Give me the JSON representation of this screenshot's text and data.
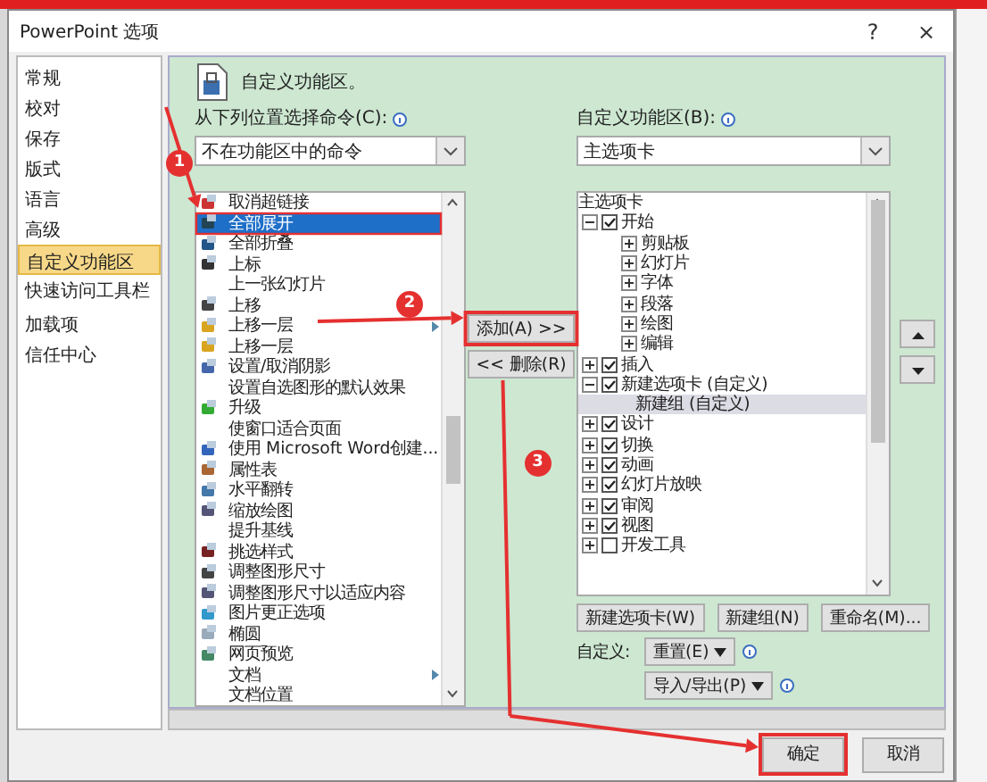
{
  "window": {
    "title": "PowerPoint 选项",
    "help": "?",
    "close": "×"
  },
  "sidebar": {
    "groups": [
      {
        "items": [
          {
            "label": "常规",
            "selected": false
          },
          {
            "label": "校对",
            "selected": false
          },
          {
            "label": "保存",
            "selected": false
          },
          {
            "label": "版式",
            "selected": false
          },
          {
            "label": "语言",
            "selected": false
          },
          {
            "label": "高级",
            "selected": false
          },
          {
            "label": "自定义功能区",
            "selected": true
          },
          {
            "label": "快速访问工具栏",
            "selected": false
          }
        ]
      },
      {
        "items": [
          {
            "label": "加载项",
            "selected": false
          },
          {
            "label": "信任中心",
            "selected": false
          }
        ]
      }
    ]
  },
  "header": {
    "title": "自定义功能区。"
  },
  "commands": {
    "label": "从下列位置选择命令(C):",
    "dropdown": "不在功能区中的命令",
    "items": [
      {
        "label": "取消超链接",
        "icon": true,
        "submenu": false,
        "selected": false
      },
      {
        "label": "全部展开",
        "icon": true,
        "submenu": false,
        "selected": true
      },
      {
        "label": "全部折叠",
        "icon": true,
        "submenu": false,
        "selected": false
      },
      {
        "label": "上标",
        "icon": true,
        "submenu": false,
        "selected": false
      },
      {
        "label": "上一张幻灯片",
        "icon": false,
        "submenu": false,
        "selected": false
      },
      {
        "label": "上移",
        "icon": true,
        "submenu": false,
        "selected": false
      },
      {
        "label": "上移一层",
        "icon": true,
        "submenu": true,
        "selected": false
      },
      {
        "label": "上移一层",
        "icon": true,
        "submenu": false,
        "selected": false
      },
      {
        "label": "设置/取消阴影",
        "icon": true,
        "submenu": false,
        "selected": false
      },
      {
        "label": "设置自选图形的默认效果",
        "icon": false,
        "submenu": false,
        "selected": false
      },
      {
        "label": "升级",
        "icon": true,
        "submenu": false,
        "selected": false
      },
      {
        "label": "使窗口适合页面",
        "icon": false,
        "submenu": false,
        "selected": false
      },
      {
        "label": "使用 Microsoft Word创建...",
        "icon": true,
        "submenu": false,
        "selected": false
      },
      {
        "label": "属性表",
        "icon": true,
        "submenu": false,
        "selected": false
      },
      {
        "label": "水平翻转",
        "icon": true,
        "submenu": false,
        "selected": false
      },
      {
        "label": "缩放绘图",
        "icon": true,
        "submenu": false,
        "selected": false
      },
      {
        "label": "提升基线",
        "icon": false,
        "submenu": false,
        "selected": false
      },
      {
        "label": "挑选样式",
        "icon": true,
        "submenu": false,
        "selected": false
      },
      {
        "label": "调整图形尺寸",
        "icon": true,
        "submenu": false,
        "selected": false
      },
      {
        "label": "调整图形尺寸以适应内容",
        "icon": true,
        "submenu": false,
        "selected": false
      },
      {
        "label": "图片更正选项",
        "icon": true,
        "submenu": false,
        "selected": false
      },
      {
        "label": "椭圆",
        "icon": true,
        "submenu": false,
        "selected": false
      },
      {
        "label": "网页预览",
        "icon": true,
        "submenu": false,
        "selected": false
      },
      {
        "label": "文档",
        "icon": false,
        "submenu": true,
        "selected": false
      },
      {
        "label": "文档位置",
        "icon": false,
        "submenu": false,
        "selected": false
      }
    ]
  },
  "transfer": {
    "add": "添加(A) >>",
    "remove": "<< 删除(R)"
  },
  "ribbon": {
    "label": "自定义功能区(B):",
    "dropdown": "主选项卡",
    "tree_header": "主选项卡",
    "tree": [
      {
        "kind": "tab",
        "label": "开始",
        "checked": true,
        "expanded": true,
        "selected": false,
        "children": [
          {
            "kind": "group",
            "label": "剪贴板",
            "expanded": false,
            "selected": false
          },
          {
            "kind": "group",
            "label": "幻灯片",
            "expanded": false,
            "selected": false
          },
          {
            "kind": "group",
            "label": "字体",
            "expanded": false,
            "selected": false
          },
          {
            "kind": "group",
            "label": "段落",
            "expanded": false,
            "selected": false
          },
          {
            "kind": "group",
            "label": "绘图",
            "expanded": false,
            "selected": false
          },
          {
            "kind": "group",
            "label": "编辑",
            "expanded": false,
            "selected": false
          }
        ]
      },
      {
        "kind": "tab",
        "label": "插入",
        "checked": true,
        "expanded": false,
        "selected": false
      },
      {
        "kind": "tab",
        "label": "新建选项卡 (自定义)",
        "checked": true,
        "expanded": true,
        "selected": false,
        "children": [
          {
            "kind": "custom",
            "label": "新建组 (自定义)",
            "selected": true
          }
        ]
      },
      {
        "kind": "tab",
        "label": "设计",
        "checked": true,
        "expanded": false,
        "selected": false
      },
      {
        "kind": "tab",
        "label": "切换",
        "checked": true,
        "expanded": false,
        "selected": false
      },
      {
        "kind": "tab",
        "label": "动画",
        "checked": true,
        "expanded": false,
        "selected": false
      },
      {
        "kind": "tab",
        "label": "幻灯片放映",
        "checked": true,
        "expanded": false,
        "selected": false
      },
      {
        "kind": "tab",
        "label": "审阅",
        "checked": true,
        "expanded": false,
        "selected": false
      },
      {
        "kind": "tab",
        "label": "视图",
        "checked": true,
        "expanded": false,
        "selected": false
      },
      {
        "kind": "tab",
        "label": "开发工具",
        "checked": false,
        "expanded": false,
        "selected": false
      }
    ],
    "buttons": [
      "新建选项卡(W)",
      "新建组(N)",
      "重命名(M)..."
    ],
    "customize_label": "自定义:",
    "reset": "重置(E)",
    "import_export": "导入/导出(P)"
  },
  "footer": {
    "ok": "确定",
    "cancel": "取消"
  },
  "annotations": [
    "1",
    "2",
    "3"
  ]
}
